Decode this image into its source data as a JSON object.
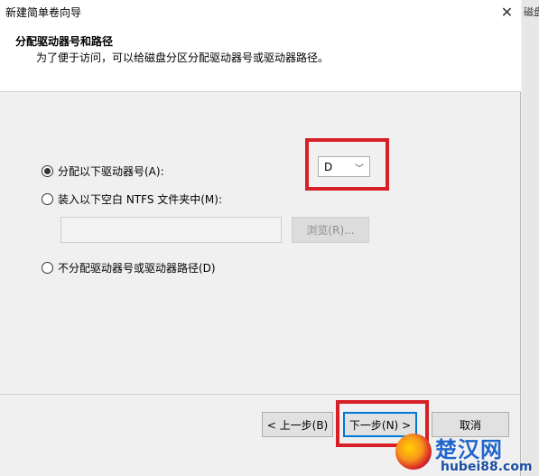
{
  "window": {
    "title": "新建简单卷向导",
    "close_glyph": "✕"
  },
  "header": {
    "title": "分配驱动器号和路径",
    "subtitle": "为了便于访问，可以给磁盘分区分配驱动器号或驱动器路径。"
  },
  "options": {
    "assign_letter_label": "分配以下驱动器号(A):",
    "mount_folder_label": "装入以下空白 NTFS 文件夹中(M):",
    "no_assign_label": "不分配驱动器号或驱动器路径(D)",
    "selected": "assign_letter"
  },
  "drive_select": {
    "value": "D",
    "chevron": "﹀"
  },
  "mount_path": {
    "value": "",
    "browse_label": "浏览(R)..."
  },
  "footer": {
    "back_label": "< 上一步(B)",
    "next_label": "下一步(N) >",
    "cancel_label": "取消"
  },
  "background_window": {
    "partial_title": "磁盘"
  },
  "watermark": {
    "title": "楚汉网",
    "url": "hubei88.com"
  },
  "colors": {
    "highlight": "#d61f26",
    "focus": "#0078d7"
  }
}
